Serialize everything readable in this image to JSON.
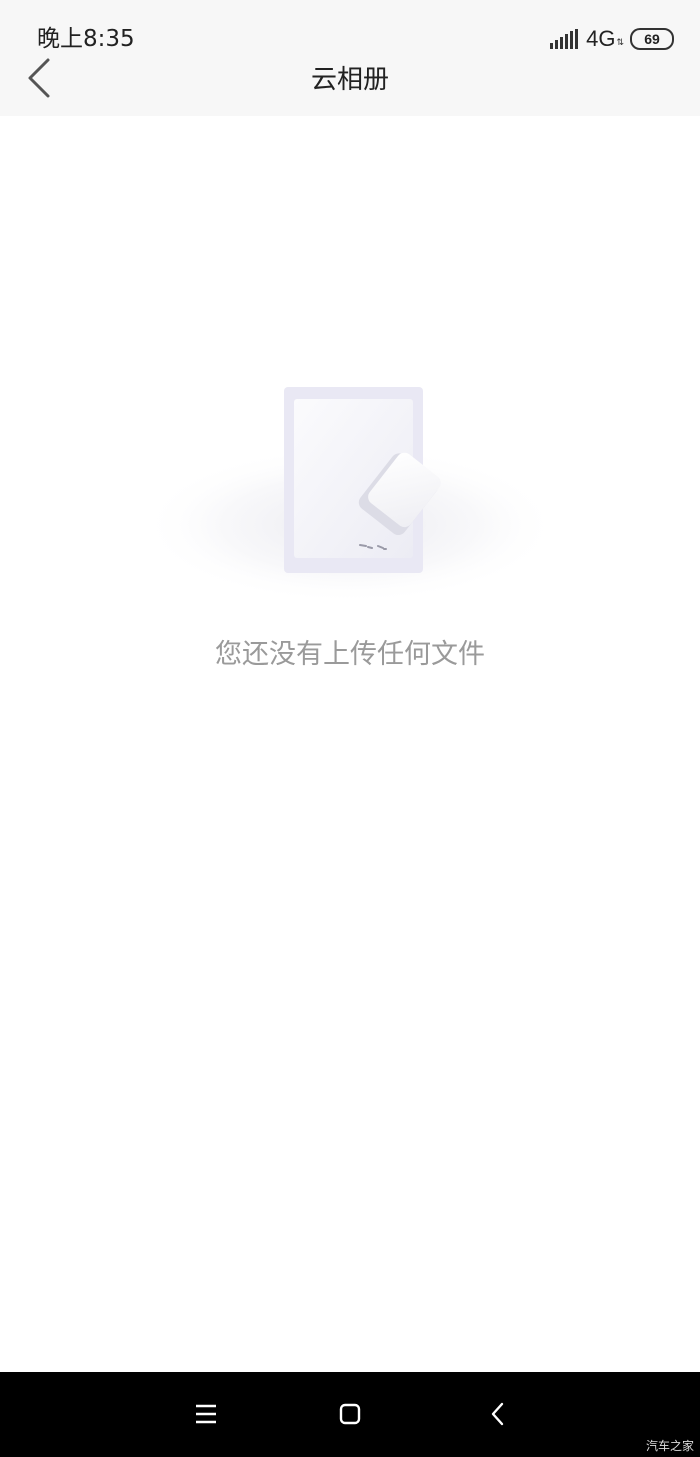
{
  "status_bar": {
    "time": "晚上8:35",
    "network": "4G",
    "battery": "69",
    "icons": [
      "signal-icon",
      "network-arrows-icon",
      "battery-icon"
    ]
  },
  "header": {
    "title": "云相册",
    "back_icon": "back-arrow-icon"
  },
  "empty_state": {
    "illustration": "empty-document-eraser-icon",
    "message": "您还没有上传任何文件"
  },
  "nav_bar": {
    "icons": [
      "menu-icon",
      "home-icon",
      "back-icon"
    ]
  },
  "watermark": "汽车之家",
  "colors": {
    "header_bg": "#f7f7f7",
    "page_bg": "#ffffff",
    "message_text": "#9a9a9a",
    "nav_bg": "#000000"
  }
}
